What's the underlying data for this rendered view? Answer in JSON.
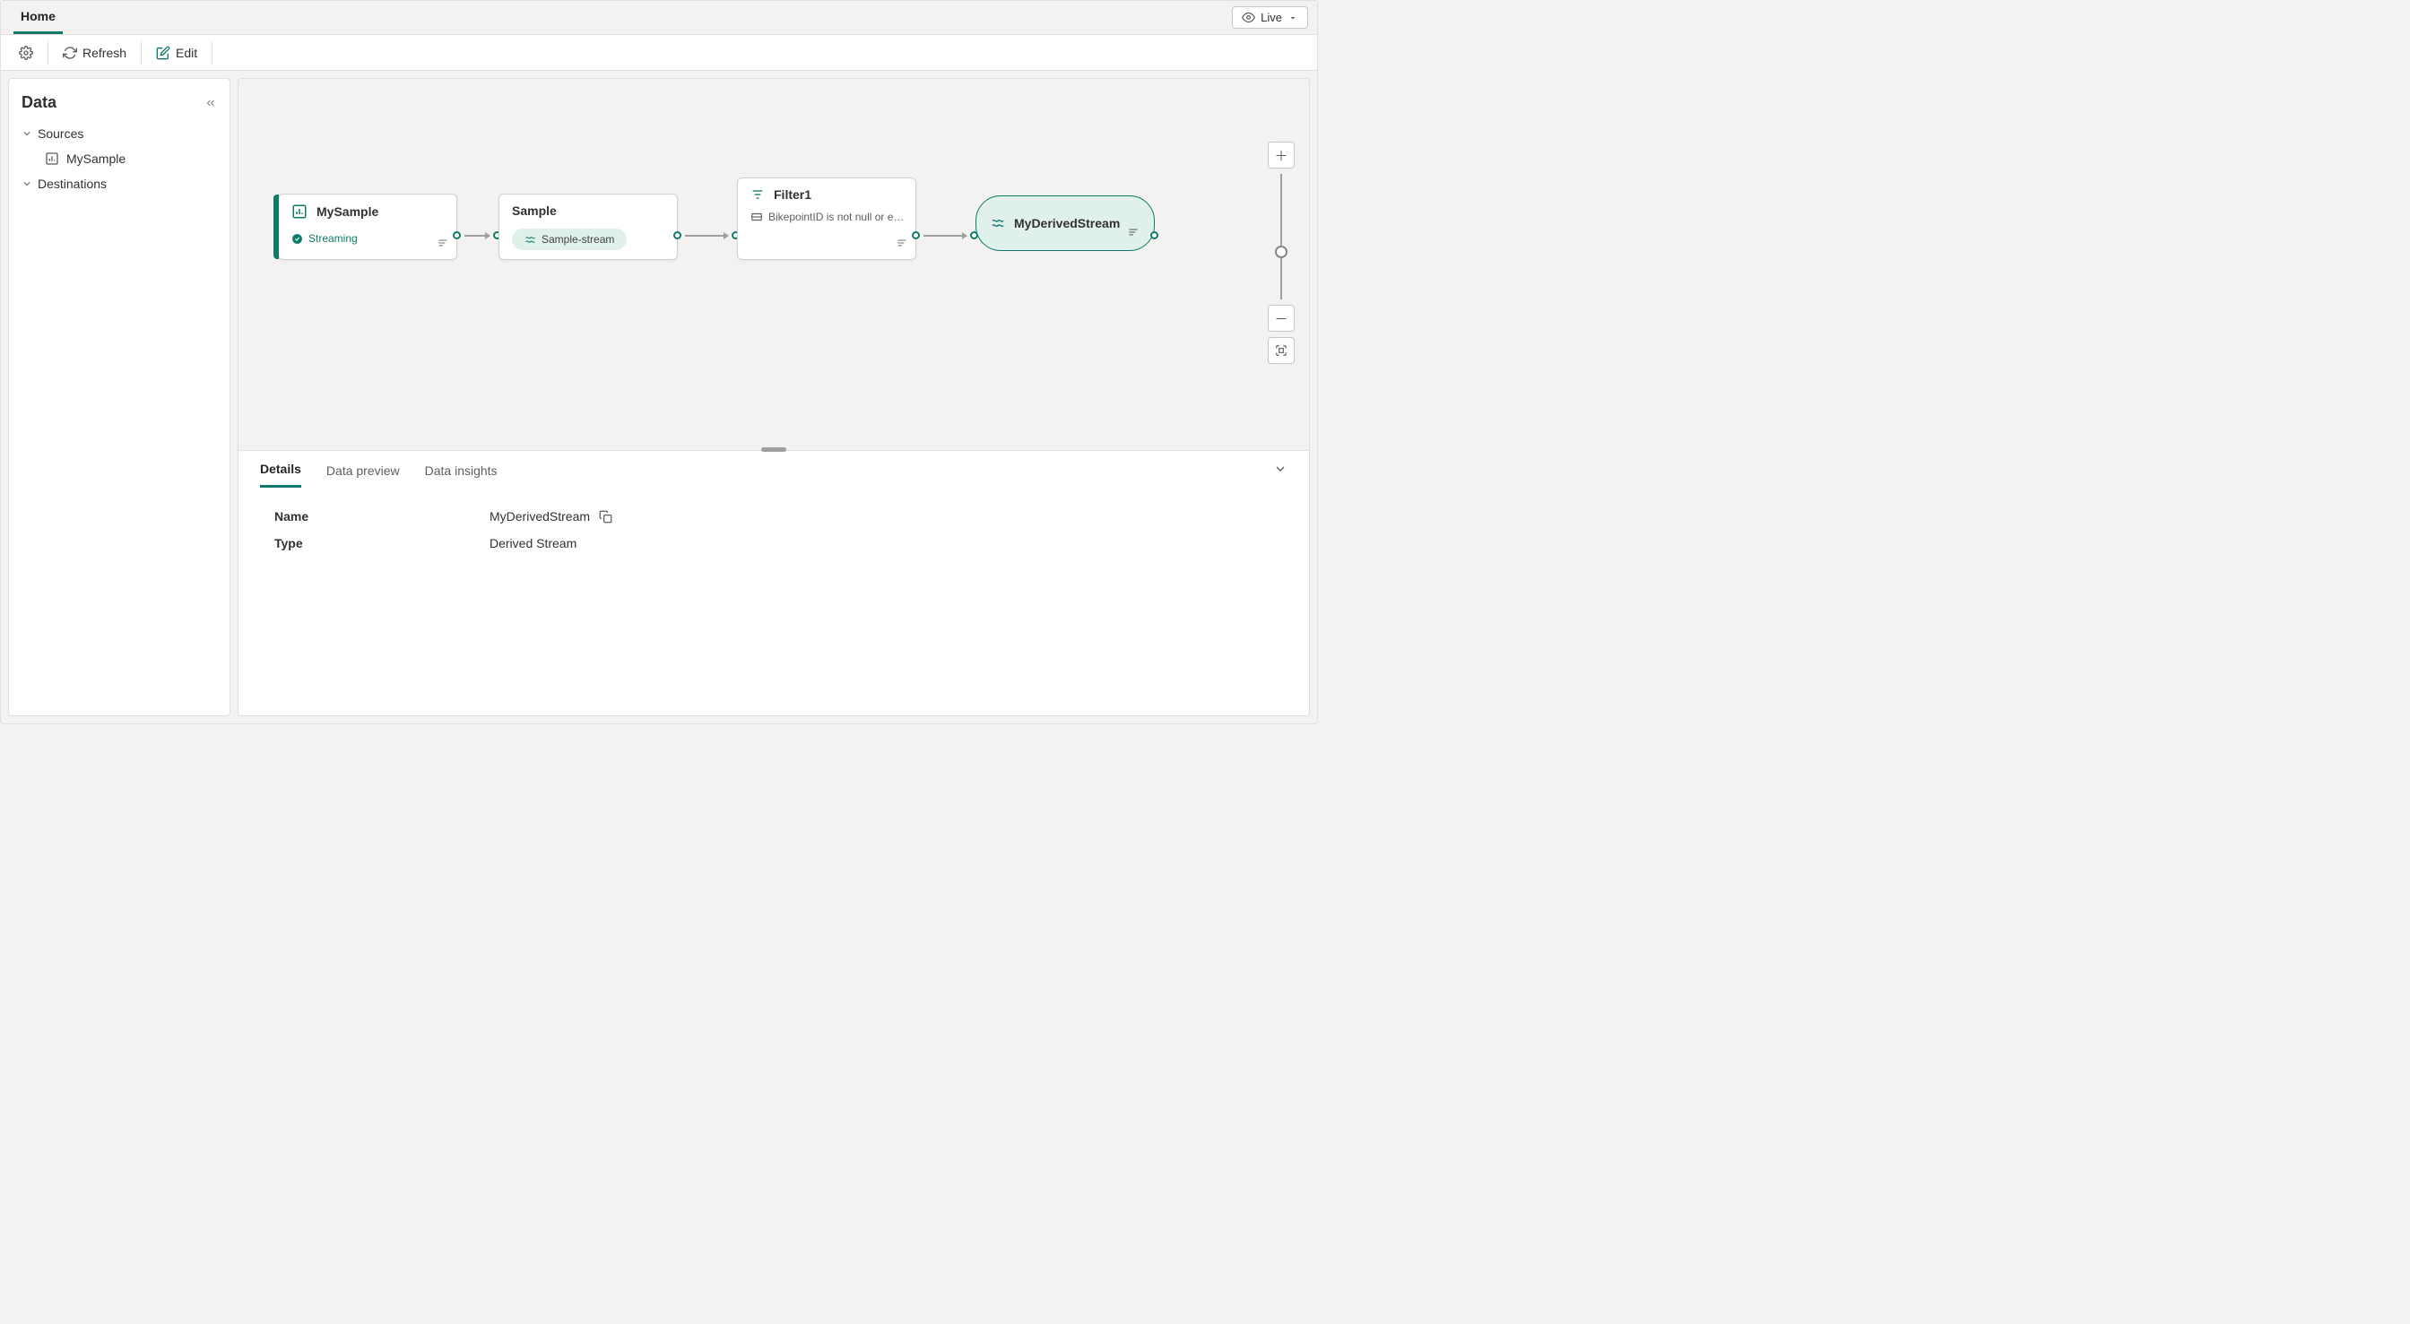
{
  "ribbon": {
    "tab": "Home",
    "mode": "Live"
  },
  "toolbar": {
    "refresh": "Refresh",
    "edit": "Edit"
  },
  "sidebar": {
    "title": "Data",
    "groups": {
      "sources": {
        "label": "Sources",
        "items": [
          "MySample"
        ]
      },
      "destinations": {
        "label": "Destinations"
      }
    }
  },
  "canvas": {
    "node1": {
      "title": "MySample",
      "status": "Streaming"
    },
    "node2": {
      "title": "Sample",
      "chip": "Sample-stream"
    },
    "node3": {
      "title": "Filter1",
      "sub": "BikepointID is not null or e…"
    },
    "node4": {
      "title": "MyDerivedStream"
    }
  },
  "panel": {
    "tabs": {
      "details": "Details",
      "preview": "Data preview",
      "insights": "Data insights"
    },
    "details": {
      "nameLabel": "Name",
      "nameValue": "MyDerivedStream",
      "typeLabel": "Type",
      "typeValue": "Derived Stream"
    }
  }
}
